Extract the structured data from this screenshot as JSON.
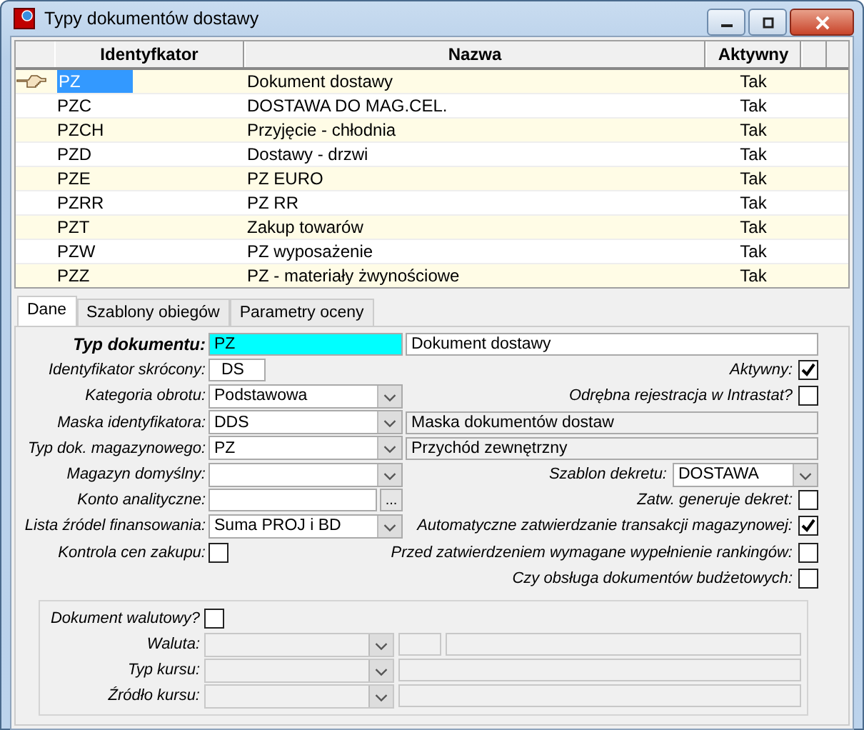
{
  "window": {
    "title": "Typy dokumentów dostawy"
  },
  "table": {
    "columns": [
      "Identyfkator",
      "Nazwa",
      "Aktywny"
    ],
    "rows": [
      {
        "cells": [
          "PZ",
          "Dokument dostawy",
          "Tak"
        ],
        "selected": true
      },
      {
        "cells": [
          "PZC",
          "DOSTAWA DO MAG.CEL.",
          "Tak"
        ],
        "selected": false
      },
      {
        "cells": [
          "PZCH",
          "Przyjęcie - chłodnia",
          "Tak"
        ],
        "selected": false
      },
      {
        "cells": [
          "PZD",
          "Dostawy - drzwi",
          "Tak"
        ],
        "selected": false
      },
      {
        "cells": [
          "PZE",
          "PZ EURO",
          "Tak"
        ],
        "selected": false
      },
      {
        "cells": [
          "PZRR",
          "PZ RR",
          "Tak"
        ],
        "selected": false
      },
      {
        "cells": [
          "PZT",
          "Zakup towarów",
          "Tak"
        ],
        "selected": false
      },
      {
        "cells": [
          "PZW",
          "PZ wyposażenie",
          "Tak"
        ],
        "selected": false
      },
      {
        "cells": [
          "PZZ",
          "PZ - materiały żwynościowe",
          "Tak"
        ],
        "selected": false
      }
    ]
  },
  "tabs": [
    {
      "label": "Dane",
      "selected": true
    },
    {
      "label": "Szablony obiegów",
      "selected": false
    },
    {
      "label": "Parametry oceny",
      "selected": false
    }
  ],
  "form": {
    "rows": [
      {
        "left": {
          "label": "Typ dokumentu:",
          "required": true,
          "kind": "text",
          "value": "PZ",
          "focused": true
        },
        "right": {
          "kind": "desc",
          "value": "Dokument dostawy",
          "readonly": false
        }
      },
      {
        "left": {
          "label": "Identyfikator skrócony:",
          "required": false,
          "kind": "short",
          "value": "DS"
        },
        "right": {
          "kind": "check",
          "label": "Aktywny:",
          "checked": true
        }
      },
      {
        "left": {
          "label": "Kategoria obrotu:",
          "required": false,
          "kind": "combo",
          "value": "Podstawowa"
        },
        "right": {
          "kind": "check",
          "label": "Odrębna rejestracja w Intrastat?",
          "checked": false
        }
      },
      {
        "left": {
          "label": "Maska identyfikatora:",
          "required": false,
          "kind": "combo",
          "value": "DDS"
        },
        "right": {
          "kind": "desc",
          "value": "Maska dokumentów dostaw",
          "readonly": true
        }
      },
      {
        "left": {
          "label": "Typ dok. magazynowego:",
          "required": false,
          "kind": "combo",
          "value": "PZ"
        },
        "right": {
          "kind": "desc",
          "value": "Przychód zewnętrzny",
          "readonly": true
        }
      },
      {
        "left": {
          "label": "Magazyn domyślny:",
          "required": false,
          "kind": "combo"
        },
        "right": {
          "kind": "combo",
          "label": "Szablon dekretu:",
          "value": "DOSTAWA"
        }
      },
      {
        "left": {
          "label": "Konto analityczne:",
          "required": false,
          "kind": "lookup",
          "button": "..."
        },
        "right": {
          "kind": "check",
          "label": "Zatw. generuje dekret:",
          "checked": false
        }
      },
      {
        "left": {
          "label": "Lista źródel finansowania:",
          "required": false,
          "kind": "combo",
          "value": "Suma PROJ i BD"
        },
        "right": {
          "kind": "check",
          "label": "Automatyczne zatwierdzanie transakcji magazynowej:",
          "checked": true
        }
      },
      {
        "left": {
          "label": "Kontrola cen zakupu:",
          "required": false,
          "kind": "check",
          "checked": false
        },
        "right": {
          "kind": "check",
          "label": "Przed zatwierdzeniem wymagane wypełnienie rankingów:",
          "checked": false
        }
      },
      {
        "right": {
          "kind": "check",
          "label": "Czy obsługa dokumentów budżetowych:",
          "checked": false
        }
      }
    ]
  },
  "currency": {
    "check": {
      "label": "Dokument walutowy?",
      "checked": false
    },
    "rows": [
      {
        "label": "Waluta:",
        "fields": [
          {
            "kind": "combo",
            "disabled": true
          },
          {
            "kind": "code",
            "disabled": true
          },
          {
            "kind": "text",
            "disabled": true
          }
        ]
      },
      {
        "label": "Typ kursu:",
        "fields": [
          {
            "kind": "combo",
            "disabled": true
          },
          {
            "kind": "wide",
            "disabled": true
          }
        ]
      },
      {
        "label": "Źródło kursu:",
        "fields": [
          {
            "kind": "combo",
            "disabled": true
          },
          {
            "kind": "wide",
            "disabled": true
          }
        ]
      }
    ]
  }
}
